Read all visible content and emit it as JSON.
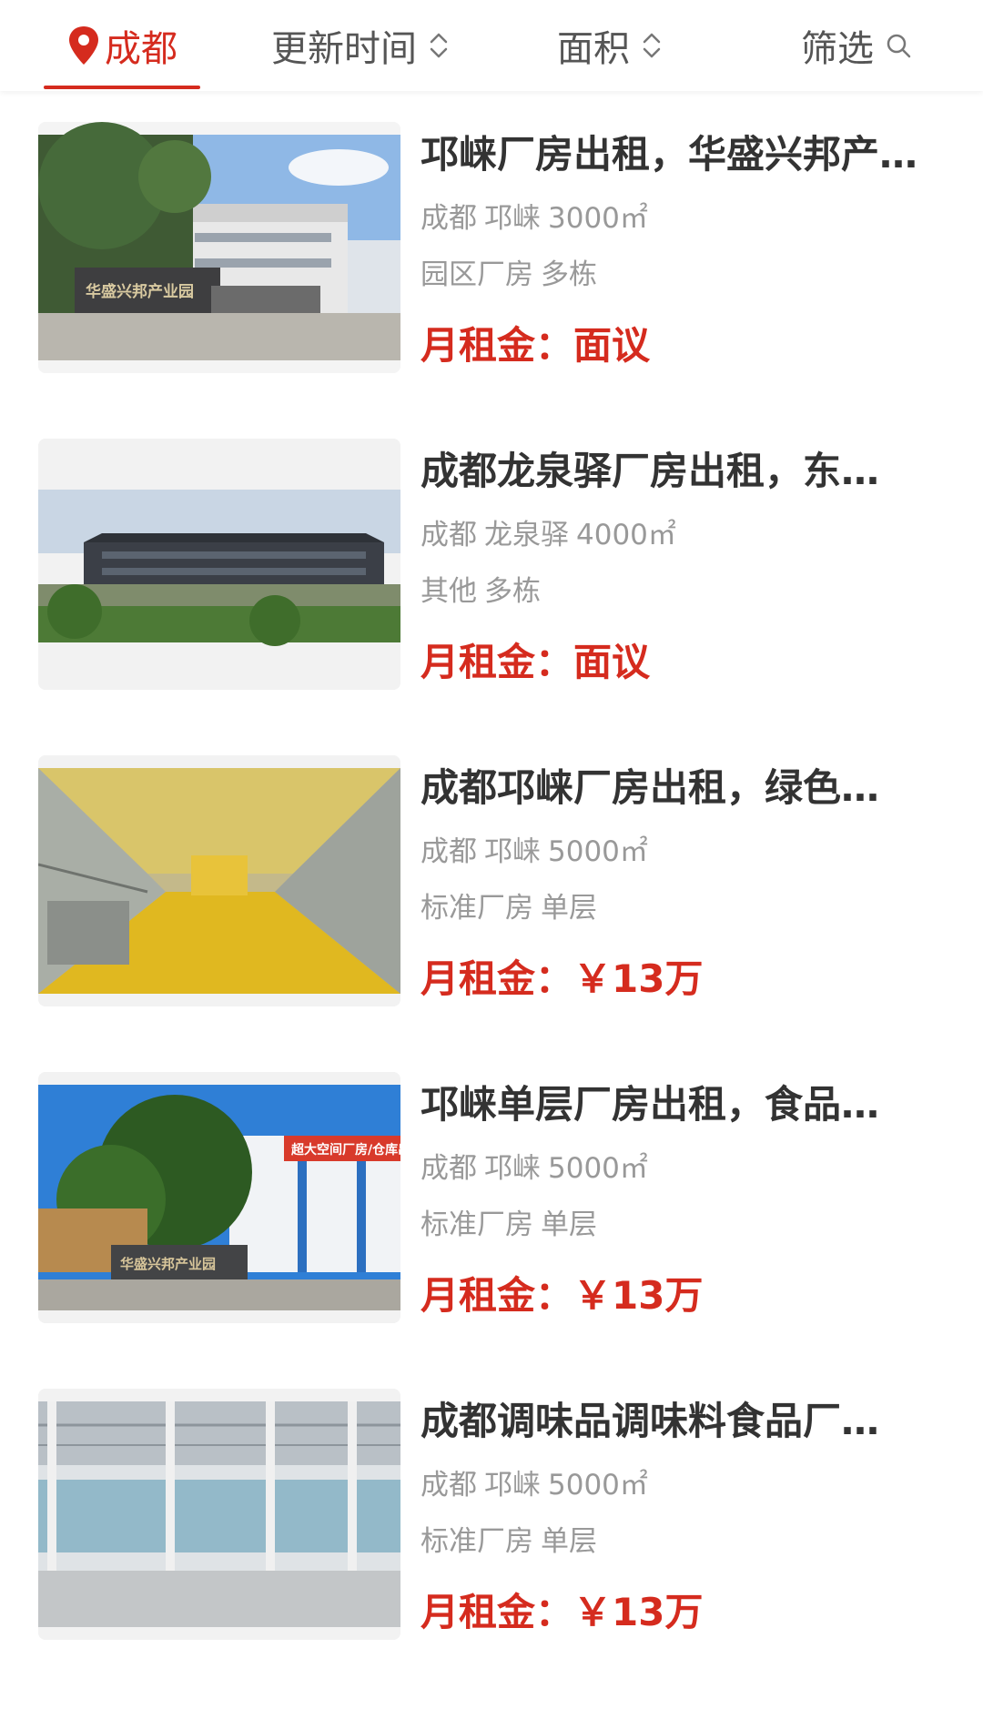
{
  "filters": {
    "city": "成都",
    "update_time": "更新时间",
    "area": "面积",
    "filter": "筛选",
    "icons": [
      "location-pin-icon",
      "sort-updown-icon",
      "search-icon"
    ],
    "accent_color": "#d52b1e"
  },
  "listings": [
    {
      "title": "邛崃厂房出租，华盛兴邦产业园…",
      "city": "成都",
      "district": "邛崃",
      "area": "3000㎡",
      "type": "园区厂房",
      "floors": "多栋",
      "price_label": "月租金：",
      "price": "面议",
      "sign_text": "华盛兴邦产业园"
    },
    {
      "title": "成都龙泉驿厂房出租，东…",
      "city": "成都",
      "district": "龙泉驿",
      "area": "4000㎡",
      "type": "其他",
      "floors": "多栋",
      "price_label": "月租金：",
      "price": "面议"
    },
    {
      "title": "成都邛崃厂房出租，绿色…",
      "city": "成都",
      "district": "邛崃",
      "area": "5000㎡",
      "type": "标准厂房",
      "floors": "单层",
      "price_label": "月租金：",
      "price": "￥13万"
    },
    {
      "title": "邛崃单层厂房出租，食品…",
      "city": "成都",
      "district": "邛崃",
      "area": "5000㎡",
      "type": "标准厂房",
      "floors": "单层",
      "price_label": "月租金：",
      "price": "￥13万",
      "sign_text": "华盛兴邦产业园",
      "banner_text": "超大空间厂房/仓库出租"
    },
    {
      "title": "成都调味品调味料食品厂…",
      "city": "成都",
      "district": "邛崃",
      "area": "5000㎡",
      "type": "标准厂房",
      "floors": "单层",
      "price_label": "月租金：",
      "price": "￥13万"
    }
  ]
}
